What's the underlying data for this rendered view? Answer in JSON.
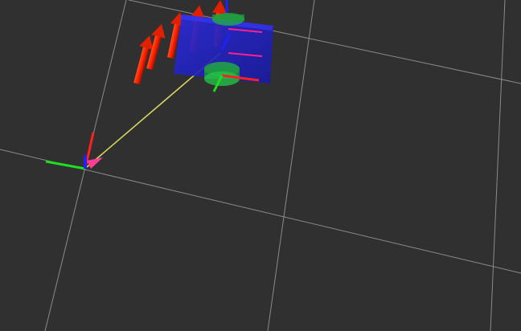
{
  "scene": {
    "background_color": "#303030",
    "grid_color": "#a0a0a0",
    "axis_colors": {
      "x": "#ff2020",
      "y": "#20dd20",
      "z": "#2020ff"
    },
    "robot_body_color": "#2020c8",
    "wheel_color": "#20b040",
    "link_line_color": "#d8d860",
    "pose_arrow_color": "#ff3c96",
    "force_arrow_color": "#ff2a00",
    "icons": [
      "world-frame-axes",
      "robot-base-frame-axes",
      "pose-arrow",
      "force-arrows"
    ]
  }
}
